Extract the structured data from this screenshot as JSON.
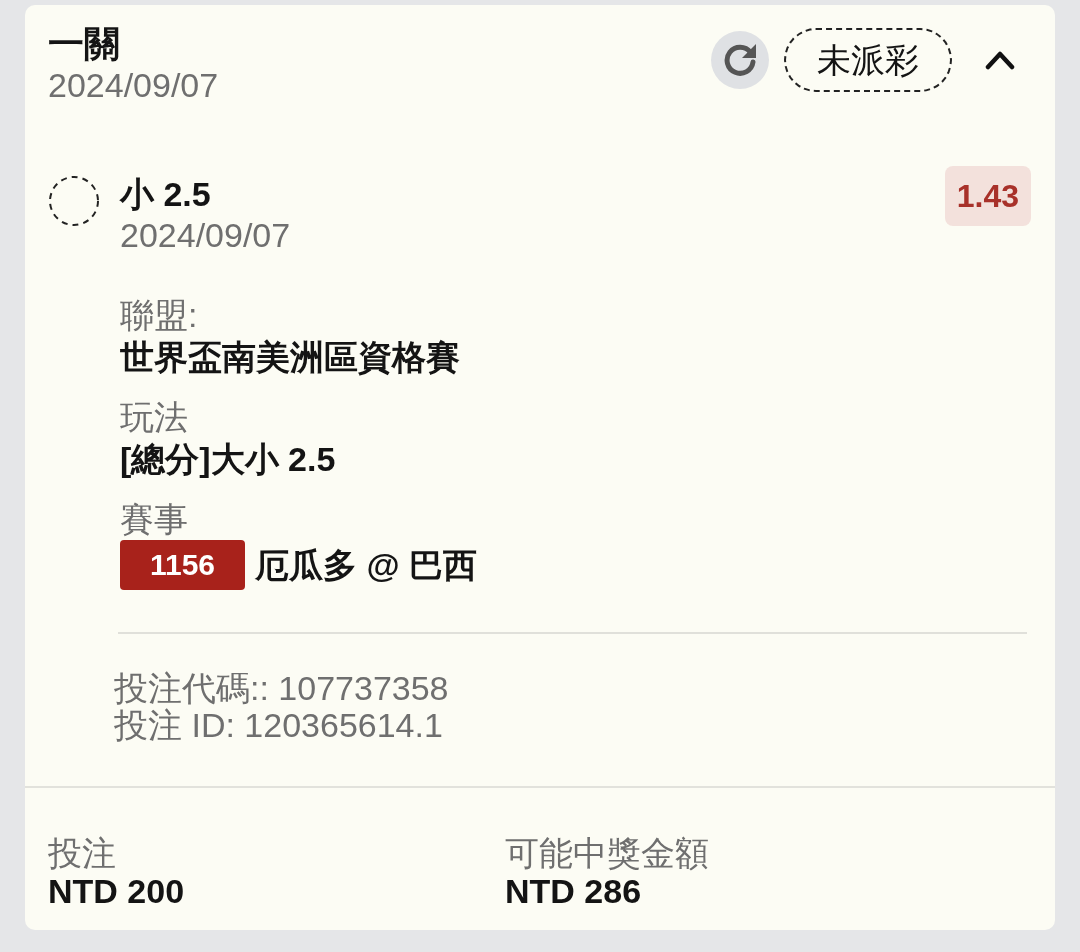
{
  "bet": {
    "title": "一關",
    "date": "2024/09/07",
    "status": "未派彩",
    "expanded": true
  },
  "selection": {
    "settled": false,
    "pick": "小 2.5",
    "date": "2024/09/07",
    "odds": "1.43"
  },
  "details": [
    {
      "label": "聯盟:",
      "value": "世界盃南美洲區資格賽"
    },
    {
      "label": "玩法",
      "value": "[總分]大小 2.5"
    },
    {
      "label": "賽事",
      "code": "1156",
      "value": "厄瓜多 @ 巴西"
    }
  ],
  "references": [
    "投注代碼:: 107737358",
    "投注 ID: 120365614.1"
  ],
  "summary": [
    {
      "label": "投注",
      "value": "NTD 200"
    },
    {
      "label": "可能中獎金額",
      "value": "NTD 286"
    }
  ]
}
